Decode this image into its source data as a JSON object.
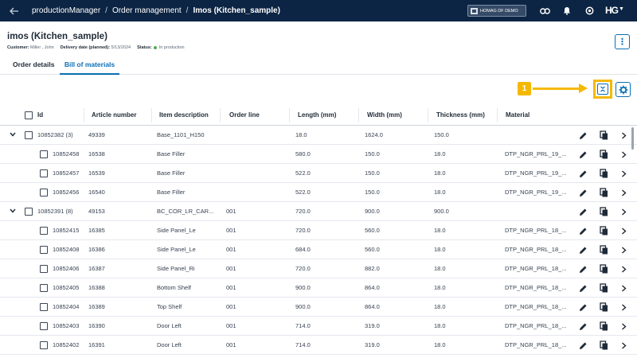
{
  "breadcrumb": {
    "items": [
      "productionManager",
      "Order management"
    ],
    "current": "Imos (Kitchen_sample)"
  },
  "tenant": {
    "label": "HOMAG DF DEMO"
  },
  "logo": {
    "text": "HG"
  },
  "header": {
    "title": "imos (Kitchen_sample)",
    "customer_label": "Customer:",
    "customer_value": "Miller , John",
    "delivery_label": "Delivery date (planned):",
    "delivery_value": "5/13/2024",
    "status_label": "Status:",
    "status_value": "In production",
    "more_glyph": "⋮"
  },
  "tabs": [
    {
      "label": "Order details",
      "active": false
    },
    {
      "label": "Bill of materials",
      "active": true
    }
  ],
  "callout": {
    "number": "1"
  },
  "table": {
    "columns": [
      "Id",
      "Article number",
      "Item description",
      "Order line",
      "Length (mm)",
      "Width (mm)",
      "Thickness (mm)",
      "Material"
    ],
    "rows": [
      {
        "group": true,
        "id": "10852382 (3)",
        "article": "49339",
        "desc": "Base_1101_H150",
        "line": "",
        "length": "18.0",
        "width": "1624.0",
        "thickness": "150.0",
        "material": ""
      },
      {
        "group": false,
        "id": "10852458",
        "article": "16538",
        "desc": "Base Filler",
        "line": "",
        "length": "580.0",
        "width": "150.0",
        "thickness": "18.0",
        "material": "DTP_NGR_PRL_19_..."
      },
      {
        "group": false,
        "id": "10852457",
        "article": "16539",
        "desc": "Base Filler",
        "line": "",
        "length": "522.0",
        "width": "150.0",
        "thickness": "18.0",
        "material": "DTP_NGR_PRL_19_..."
      },
      {
        "group": false,
        "id": "10852456",
        "article": "16540",
        "desc": "Base Filler",
        "line": "",
        "length": "522.0",
        "width": "150.0",
        "thickness": "18.0",
        "material": "DTP_NGR_PRL_19_..."
      },
      {
        "group": true,
        "id": "10852391 (8)",
        "article": "49153",
        "desc": "BC_COR_LR_CAR...",
        "line": "001",
        "length": "720.0",
        "width": "900.0",
        "thickness": "900.0",
        "material": ""
      },
      {
        "group": false,
        "id": "10852415",
        "article": "16385",
        "desc": "Side Panel_Le",
        "line": "001",
        "length": "720.0",
        "width": "560.0",
        "thickness": "18.0",
        "material": "DTP_NGR_PRL_18_..."
      },
      {
        "group": false,
        "id": "10852408",
        "article": "16386",
        "desc": "Side Panel_Le",
        "line": "001",
        "length": "684.0",
        "width": "560.0",
        "thickness": "18.0",
        "material": "DTP_NGR_PRL_18_..."
      },
      {
        "group": false,
        "id": "10852406",
        "article": "16387",
        "desc": "Side Panel_Ri",
        "line": "001",
        "length": "720.0",
        "width": "882.0",
        "thickness": "18.0",
        "material": "DTP_NGR_PRL_18_..."
      },
      {
        "group": false,
        "id": "10852405",
        "article": "16388",
        "desc": "Bottom Shelf",
        "line": "001",
        "length": "900.0",
        "width": "864.0",
        "thickness": "18.0",
        "material": "DTP_NGR_PRL_18_..."
      },
      {
        "group": false,
        "id": "10852404",
        "article": "16389",
        "desc": "Top Shelf",
        "line": "001",
        "length": "900.0",
        "width": "864.0",
        "thickness": "18.0",
        "material": "DTP_NGR_PRL_18_..."
      },
      {
        "group": false,
        "id": "10852403",
        "article": "16390",
        "desc": "Door Left",
        "line": "001",
        "length": "714.0",
        "width": "319.0",
        "thickness": "18.0",
        "material": "DTP_NGR_PRL_18_..."
      },
      {
        "group": false,
        "id": "10852402",
        "article": "16391",
        "desc": "Door Left",
        "line": "001",
        "length": "714.0",
        "width": "319.0",
        "thickness": "18.0",
        "material": "DTP_NGR_PRL_18_..."
      }
    ]
  },
  "colors": {
    "topbar": "#0d2544",
    "accent": "#0a6fb5",
    "highlight": "#f5b800",
    "status_ok": "#4caf50"
  }
}
